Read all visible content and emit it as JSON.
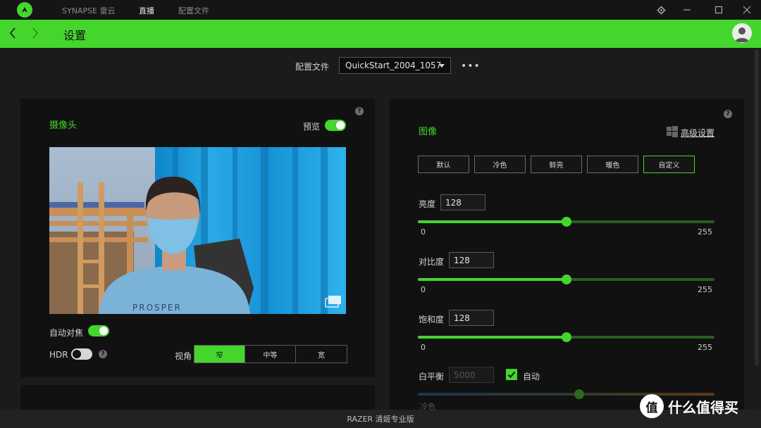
{
  "titlebar": {
    "tabs": [
      {
        "label": "SYNAPSE 雷云"
      },
      {
        "label": "直播"
      },
      {
        "label": "配置文件"
      }
    ]
  },
  "header": {
    "title": "设置"
  },
  "profile": {
    "label": "配置文件",
    "value": "QuickStart_2004_1057",
    "more": "•••"
  },
  "camera": {
    "title": "摄像头",
    "preview_label": "预览",
    "preview_on": true,
    "autofocus_label": "自动对焦",
    "autofocus_on": true,
    "hdr_label": "HDR",
    "hdr_on": false,
    "fov_label": "视角",
    "fov_options": [
      "窄",
      "中等",
      "宽"
    ],
    "fov_selected": "窄"
  },
  "image": {
    "title": "图像",
    "advanced_label": "高级设置",
    "presets": [
      "默认",
      "冷色",
      "鲜亮",
      "暖色",
      "自定义"
    ],
    "preset_selected": "自定义",
    "sliders": [
      {
        "label": "亮度",
        "value": "128",
        "min": "0",
        "max": "255"
      },
      {
        "label": "对比度",
        "value": "128",
        "min": "0",
        "max": "255"
      },
      {
        "label": "饱和度",
        "value": "128",
        "min": "0",
        "max": "255"
      }
    ],
    "white_balance": {
      "label": "白平衡",
      "value": "5000",
      "auto_label": "自动",
      "auto_checked": true,
      "cool_label": "冷色"
    }
  },
  "footer": {
    "device": "RAZER 清姬专业版"
  },
  "watermark": {
    "symbol": "值",
    "text": "什么值得买"
  },
  "colors": {
    "accent": "#44d62c",
    "background": "#1b1b1b",
    "panel": "#111111"
  }
}
